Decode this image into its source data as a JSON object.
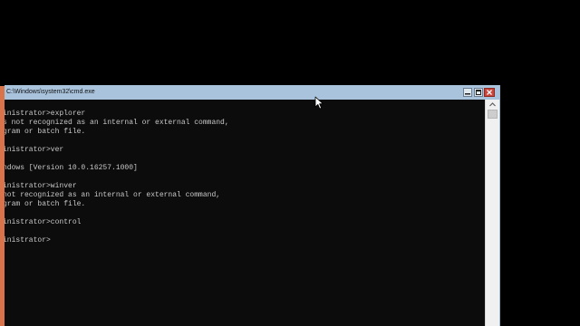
{
  "window": {
    "title": "C:\\Windows\\system32\\cmd.exe",
    "controls": {
      "minimize_icon": "minimize-icon",
      "maximize_icon": "maximize-icon",
      "close_icon": "close-icon"
    }
  },
  "console": {
    "lines": [
      "inistrator>explorer",
      "s not recognized as an internal or external command,",
      "gram or batch file.",
      "",
      "inistrator>ver",
      "",
      "ndows [Version 10.0.16257.1000]",
      "",
      "inistrator>winver",
      "not recognized as an internal or external command,",
      "gram or batch file.",
      "",
      "inistrator>control",
      "",
      "inistrator>"
    ]
  },
  "colors": {
    "desktop": "#000000",
    "console_bg": "#0c0c0c",
    "console_text": "#c8c8c8",
    "titlebar": "#a9c3dd",
    "close_button": "#c9443a",
    "accent_edge": "#d9734a"
  }
}
